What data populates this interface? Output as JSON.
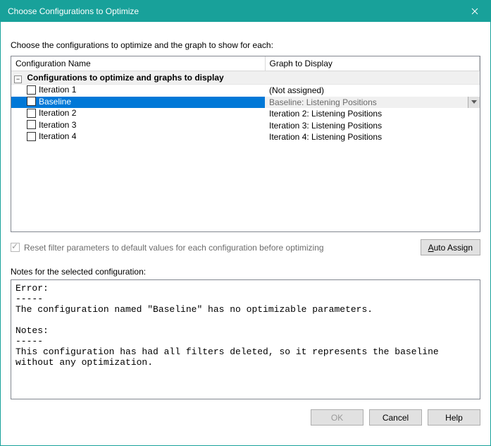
{
  "window": {
    "title": "Choose Configurations to Optimize"
  },
  "instruction": "Choose the configurations to optimize and the graph to show for each:",
  "columns": {
    "name": "Configuration Name",
    "graph": "Graph to Display"
  },
  "section_header": "Configurations to optimize and graphs to display",
  "rows": [
    {
      "label": "Iteration 1",
      "graph": "(Not assigned)",
      "selected": false
    },
    {
      "label": "Baseline",
      "graph": "Baseline: Listening Positions",
      "selected": true
    },
    {
      "label": "Iteration 2",
      "graph": "Iteration 2: Listening Positions",
      "selected": false
    },
    {
      "label": "Iteration 3",
      "graph": "Iteration 3: Listening Positions",
      "selected": false
    },
    {
      "label": "Iteration 4",
      "graph": "Iteration 4: Listening Positions",
      "selected": false
    }
  ],
  "reset_checkbox": {
    "label": "Reset filter parameters to default values for each configuration before optimizing",
    "checked": true,
    "disabled": true
  },
  "auto_assign_label": "Auto Assign",
  "notes_label": "Notes for the selected configuration:",
  "notes_text": "Error:\n-----\nThe configuration named \"Baseline\" has no optimizable parameters.\n\nNotes:\n-----\nThis configuration has had all filters deleted, so it represents the baseline without any optimization.",
  "buttons": {
    "ok": "OK",
    "cancel": "Cancel",
    "help": "Help"
  }
}
